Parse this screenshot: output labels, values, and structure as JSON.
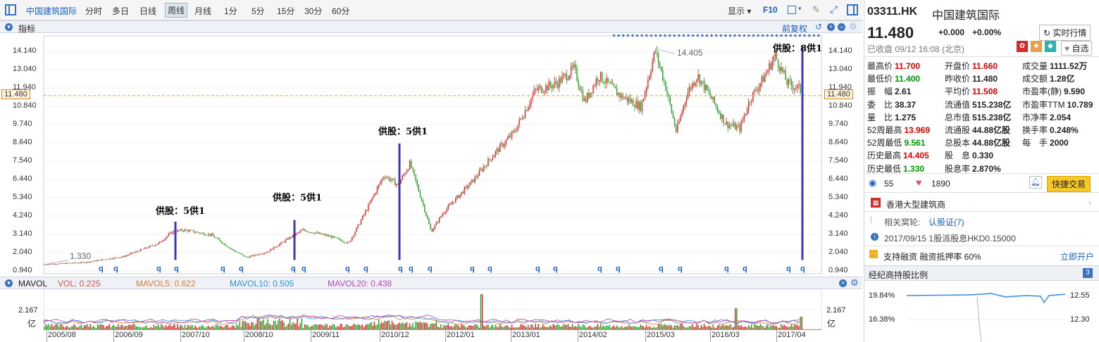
{
  "toolbar": {
    "stock_name": "中国建筑国际",
    "periods": [
      "分时",
      "多日",
      "日线",
      "周线",
      "月线",
      "1分",
      "5分",
      "15分",
      "30分",
      "60分"
    ],
    "active_period": "周线",
    "display_label": "显示",
    "f10_label": "F10"
  },
  "indicator_panel": {
    "title": "指标",
    "adjust_label": "前复权",
    "high_label": "14.405",
    "low_label": "1.330",
    "current_price_tag": "11.480",
    "y_ticks": [
      "14.140",
      "13.040",
      "11.940",
      "10.840",
      "9.740",
      "8.640",
      "7.540",
      "6.440",
      "5.340",
      "4.240",
      "3.140",
      "2.040",
      "0.940"
    ],
    "annotations": [
      "供股：5供1",
      "供股：5供1",
      "供股：5供1",
      "供股：8供1"
    ],
    "q_marker": "q"
  },
  "volume_panel": {
    "title": "MAVOL",
    "vol": "VOL: 0.225",
    "mavol5": "MAVOL5: 0.622",
    "mavol10": "MAVOL10: 0.505",
    "mavol20": "MAVOL20: 0.438",
    "y_top": "2.167",
    "y_unit": "亿"
  },
  "dates": [
    "2005/08",
    "2006/09",
    "2007/10",
    "2008/10",
    "2009/11",
    "2010/12",
    "2012/01",
    "2013/01",
    "2014/02",
    "2015/03",
    "2016/03",
    "2017/04"
  ],
  "quote": {
    "code": "03311.HK",
    "name": "中国建筑国际",
    "price": "11.480",
    "change": "+0.000",
    "change_pct": "+0.00%",
    "realtime_label": "实时行情",
    "status": "已收盘 09/12 16:08 (北京)",
    "watch_label": "自选"
  },
  "stats": [
    [
      [
        "最高价",
        "11.700",
        "red"
      ],
      [
        "开盘价",
        "11.660",
        "red"
      ],
      [
        "成交量",
        "1111.52万",
        ""
      ]
    ],
    [
      [
        "最低价",
        "11.400",
        "green"
      ],
      [
        "昨收价",
        "11.480",
        ""
      ],
      [
        "成交额",
        "1.28亿",
        ""
      ]
    ],
    [
      [
        "振　幅",
        "2.61",
        ""
      ],
      [
        "平均价",
        "11.508",
        "red"
      ],
      [
        "市盈率(静)",
        "9.590",
        ""
      ]
    ],
    [
      [
        "委　比",
        "38.37",
        ""
      ],
      [
        "流通值",
        "515.238亿",
        ""
      ],
      [
        "市盈率TTM",
        "10.789",
        ""
      ]
    ],
    [
      [
        "量　比",
        "1.275",
        ""
      ],
      [
        "总市值",
        "515.238亿",
        ""
      ],
      [
        "市净率",
        "2.054",
        ""
      ]
    ],
    [
      [
        "52周最高",
        "13.969",
        "red"
      ],
      [
        "流通股",
        "44.88亿股",
        ""
      ],
      [
        "换手率",
        "0.248%",
        ""
      ]
    ],
    [
      [
        "52周最低",
        "9.561",
        "green"
      ],
      [
        "总股本",
        "44.88亿股",
        ""
      ],
      [
        "每　手",
        "2000",
        ""
      ]
    ],
    [
      [
        "历史最高",
        "14.405",
        "red"
      ],
      [
        "股　息",
        "0.330",
        ""
      ],
      [
        "",
        "",
        " "
      ]
    ],
    [
      [
        "历史最低",
        "1.330",
        "green"
      ],
      [
        "股息率",
        "2.870%",
        ""
      ],
      [
        "",
        "",
        " "
      ]
    ]
  ],
  "social": {
    "views": "55",
    "likes": "1890",
    "trade_label": "快捷交易"
  },
  "info": {
    "sector": "香港大型建筑商",
    "warrants_label": "相关窝轮:",
    "warrants_link": "认股证(7)",
    "dividend": "2017/09/15 1股派股息HKD0.15000",
    "margin": "支持融资 融资抵押率 60%",
    "open_account": "立即开户"
  },
  "broker": {
    "title": "经纪商持股比例",
    "left_ticks": [
      "19.84%",
      "16.38%"
    ],
    "right_ticks": [
      "12.55",
      "12.30"
    ]
  }
}
